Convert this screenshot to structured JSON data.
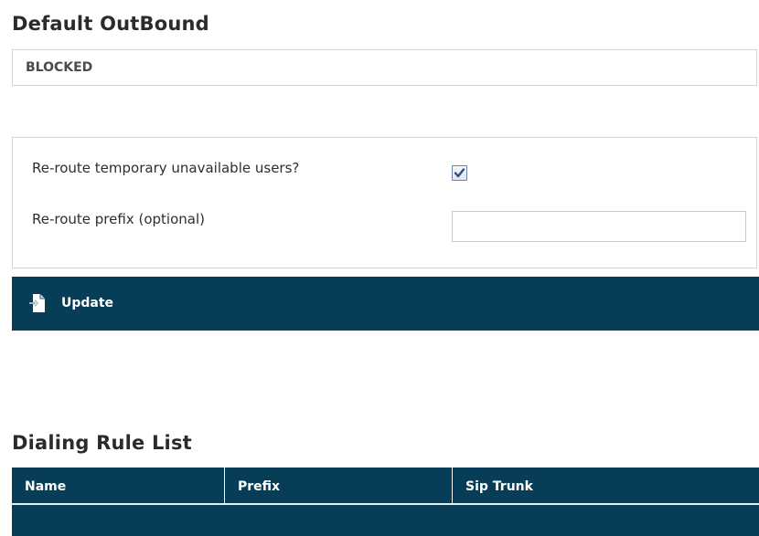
{
  "default_outbound": {
    "title": "Default OutBound",
    "status": "BLOCKED"
  },
  "options": {
    "reroute_label": "Re-route temporary unavailable users?",
    "reroute_checked": true,
    "prefix_label": "Re-route prefix (optional)",
    "prefix_value": "",
    "prefix_placeholder": ""
  },
  "update": {
    "label": "Update",
    "icon": "update-document-icon"
  },
  "dialing_rule_list": {
    "title": "Dialing Rule List",
    "columns": [
      "Name",
      "Prefix",
      "Sip Trunk"
    ],
    "rows": []
  },
  "colors": {
    "accent": "#073d57",
    "border": "#d4d4d4",
    "text": "#2e2e2e"
  }
}
